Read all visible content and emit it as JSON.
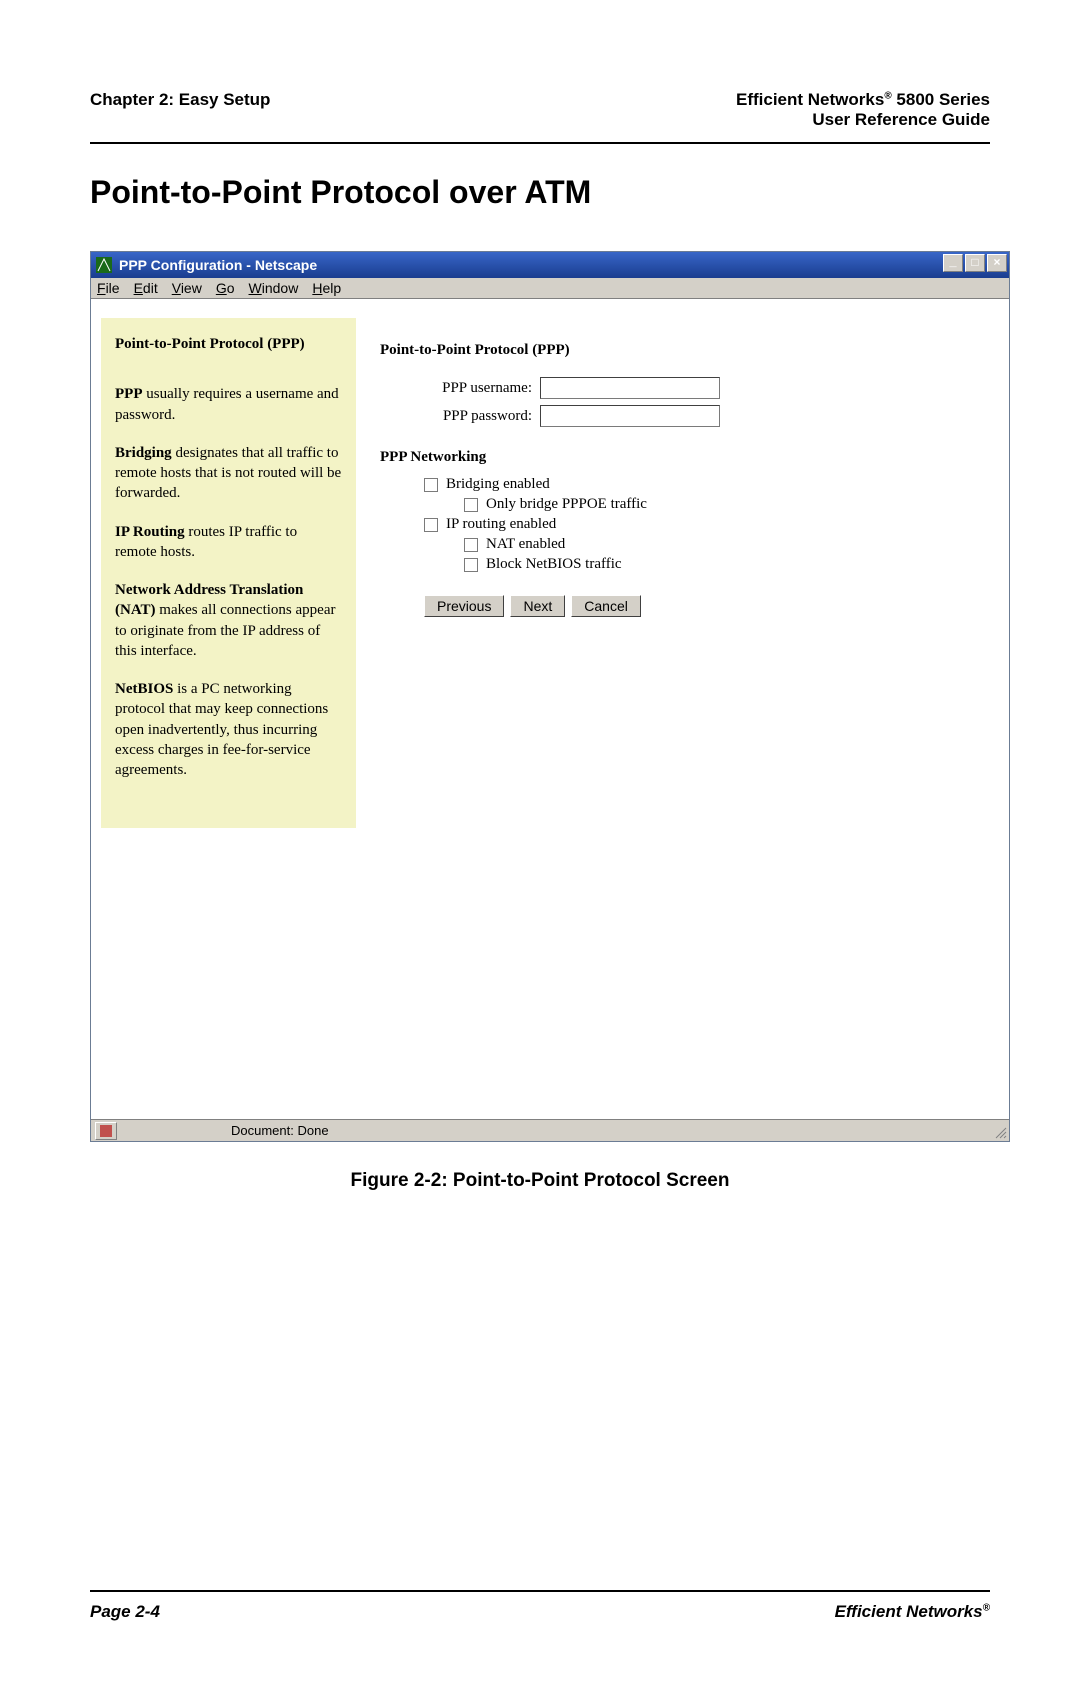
{
  "doc_header": {
    "chapter": "Chapter 2: Easy Setup",
    "product_line1": "Efficient Networks",
    "product_reg": "®",
    "product_series": " 5800 Series",
    "subtitle": "User Reference Guide"
  },
  "page_title": "Point-to-Point Protocol over ATM",
  "window": {
    "title": "PPP Configuration - Netscape",
    "menus": [
      "File",
      "Edit",
      "View",
      "Go",
      "Window",
      "Help"
    ],
    "status": "Document: Done"
  },
  "help_panel": {
    "title": "Point-to-Point Protocol (PPP)",
    "p1_bold": "PPP",
    "p1_rest": " usually requires a username and password.",
    "p2_bold": "Bridging",
    "p2_rest": " designates that all traffic to remote hosts that is not routed will be forwarded.",
    "p3_bold": "IP Routing",
    "p3_rest": " routes IP traffic to remote hosts.",
    "p4_bold": "Network Address Translation (NAT)",
    "p4_rest": " makes all connections appear to originate from the IP address of this interface.",
    "p5_bold": "NetBIOS",
    "p5_rest": " is a PC networking protocol that may keep connections open inadvertently, thus incurring excess charges in fee-for-service agreements."
  },
  "main_panel": {
    "heading": "Point-to-Point Protocol (PPP)",
    "username_label": "PPP username:",
    "username_value": "",
    "password_label": "PPP password:",
    "password_value": "",
    "networking_heading": "PPP Networking",
    "cb_bridging": "Bridging enabled",
    "cb_only_pppoe": "Only bridge PPPOE traffic",
    "cb_ip_routing": "IP routing enabled",
    "cb_nat": "NAT enabled",
    "cb_block_netbios": "Block NetBIOS traffic",
    "btn_previous": "Previous",
    "btn_next": "Next",
    "btn_cancel": "Cancel"
  },
  "figure_caption": "Figure 2-2:  Point-to-Point Protocol Screen",
  "footer": {
    "page_num": "Page 2-4",
    "brand": "Efficient Networks",
    "reg": "®"
  }
}
